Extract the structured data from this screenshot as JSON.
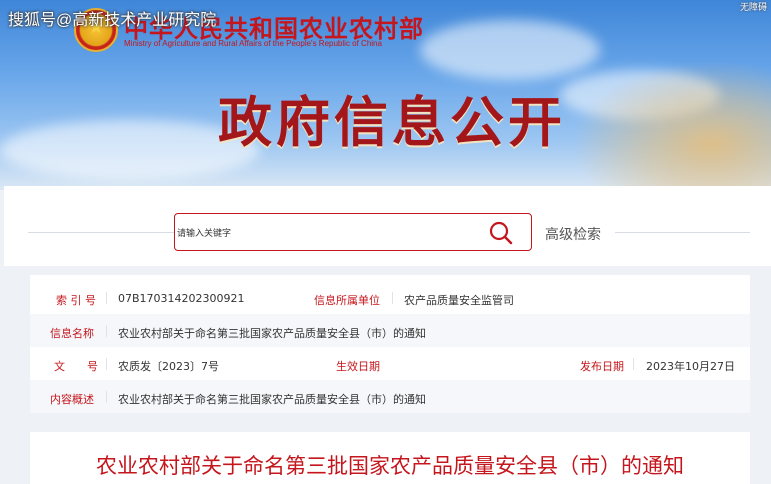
{
  "watermark": "搜狐号@高新技术产业研究院",
  "watermark_corner": "无障碍",
  "header": {
    "ministry_cn": "中华人民共和国农业农村部",
    "ministry_en": "Ministry of Agriculture and Rural Affairs of the People's Republic of China",
    "banner_title": "政府信息公开"
  },
  "search": {
    "placeholder": "请输入关键字",
    "advanced_label": "高级检索"
  },
  "meta": {
    "index_label": "索 引 号",
    "index_value": "07B170314202300921",
    "unit_label": "信息所属单位",
    "unit_value": "农产品质量安全监管司",
    "name_label": "信息名称",
    "name_value": "农业农村部关于命名第三批国家农产品质量安全县（市）的通知",
    "docno_label": "文　　号",
    "docno_value": "农质发〔2023〕7号",
    "effective_label": "生效日期",
    "effective_value": "",
    "publish_label": "发布日期",
    "publish_value": "2023年10月27日",
    "summary_label": "内容概述",
    "summary_value": "农业农村部关于命名第三批国家农产品质量安全县（市）的通知"
  },
  "notice": {
    "title": "农业农村部关于命名第三批国家农产品质量安全县（市）的通知"
  },
  "colors": {
    "accent_red": "#c4161c",
    "sky_blue": "#3f86d8"
  }
}
